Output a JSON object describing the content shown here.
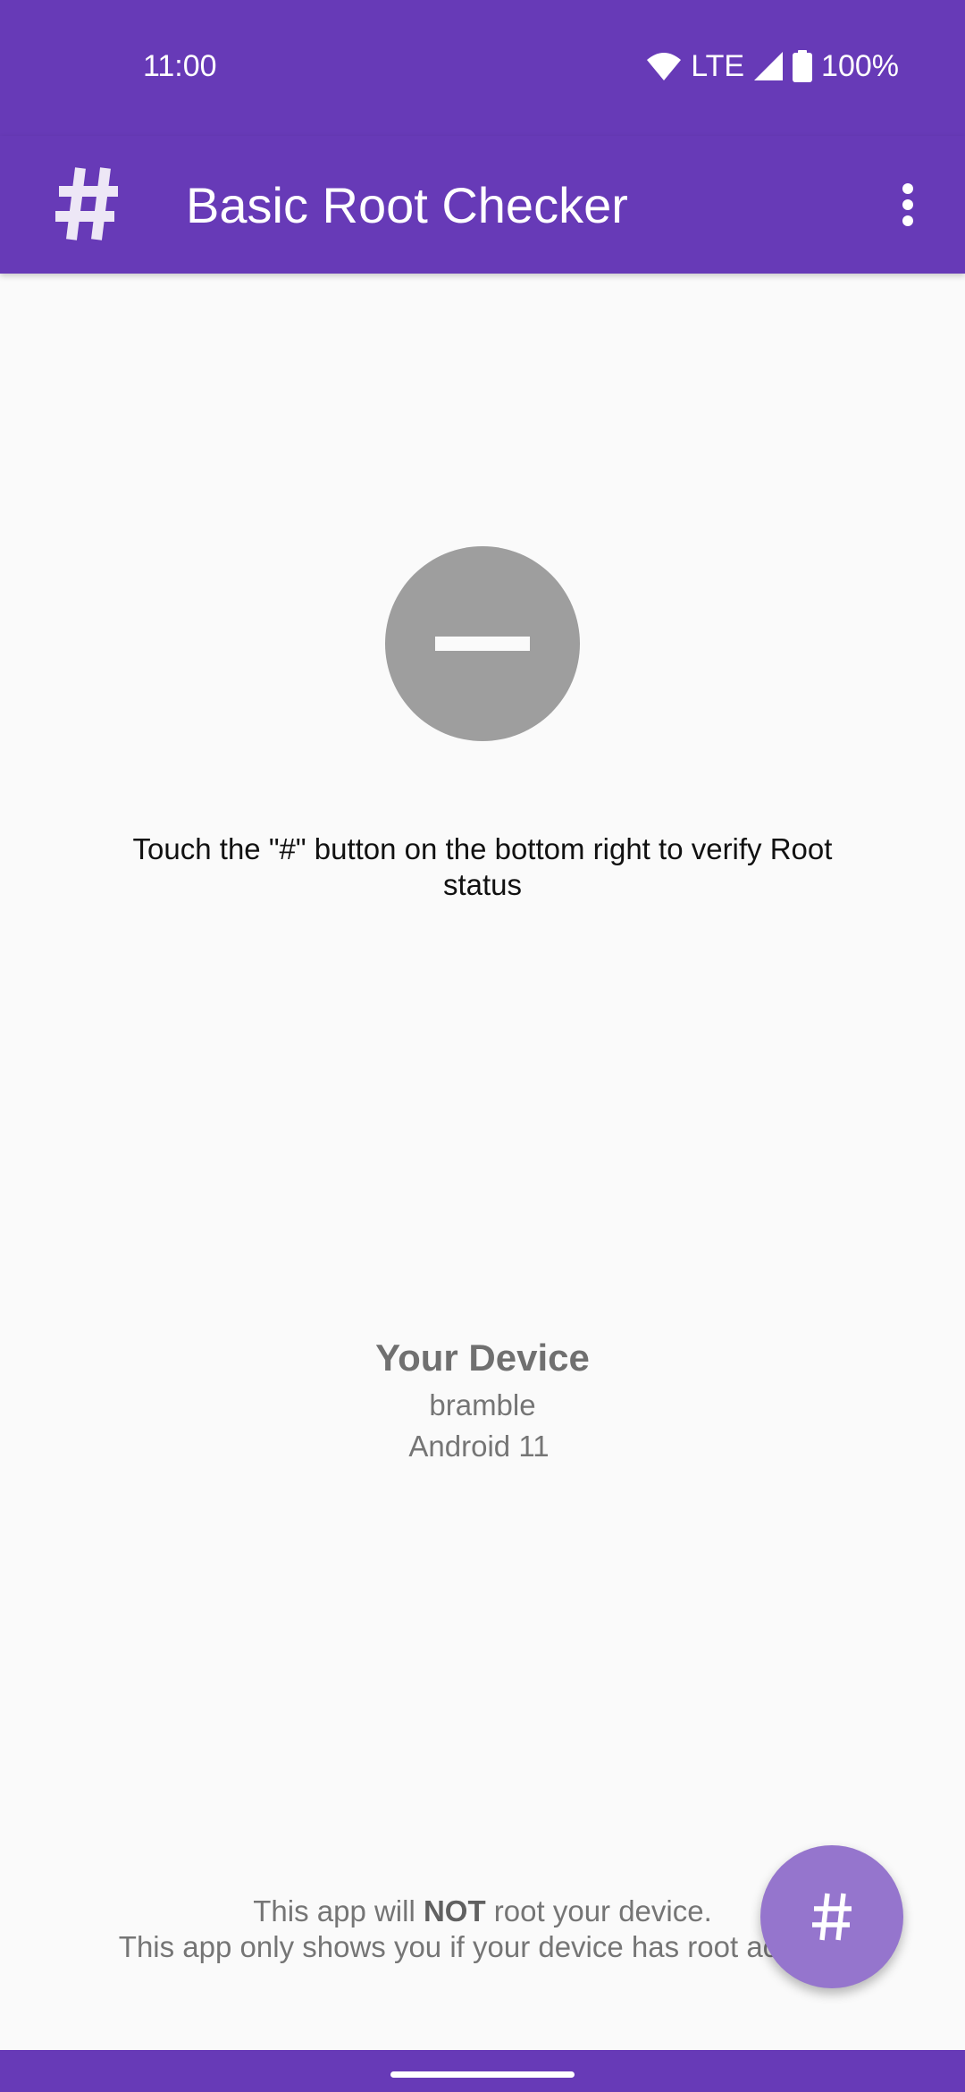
{
  "status_bar": {
    "time": "11:00",
    "network": "LTE",
    "battery": "100%",
    "icons": [
      "wifi-icon",
      "signal-icon",
      "battery-icon"
    ]
  },
  "app_bar": {
    "logo_icon": "hash-icon",
    "title": "Basic Root Checker",
    "menu_icon": "more-vert-icon"
  },
  "root_status": {
    "icon": "unknown-status-icon",
    "instruction": "Touch the \"#\" button on the bottom right to verify Root status"
  },
  "device": {
    "title": "Your Device",
    "name": "bramble",
    "os": "Android 11"
  },
  "disclaimer": {
    "line1_before": "This app will ",
    "line1_bold": "NOT",
    "line1_after": " root your device.",
    "line2": "This app only shows you if your device has root access."
  },
  "fab": {
    "icon": "hash-icon"
  },
  "colors": {
    "primary": "#673ab7",
    "fab": "#9575cd",
    "status_unknown": "#9e9e9e"
  }
}
